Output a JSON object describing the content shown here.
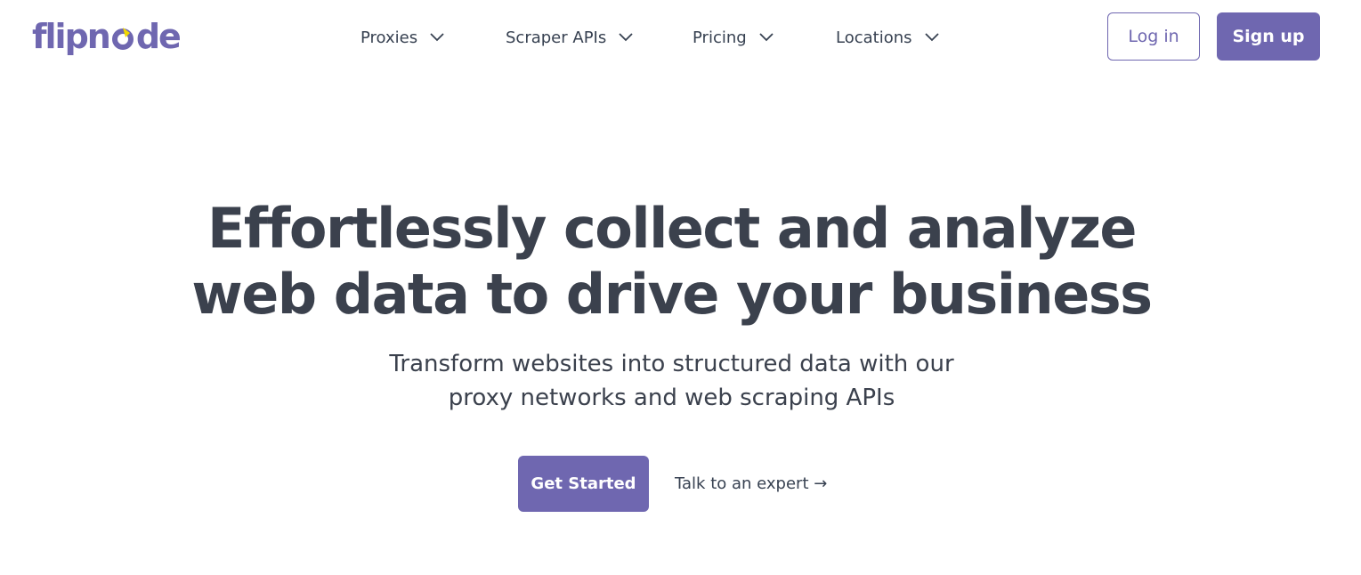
{
  "brand": {
    "logo_prefix": "flipn",
    "logo_suffix": "de",
    "primary_color": "#6f67b0",
    "accent_color": "#f1d800"
  },
  "nav": {
    "items": [
      {
        "label": "Proxies",
        "icon": "chevron-down-icon"
      },
      {
        "label": "Scraper APIs",
        "icon": "chevron-down-icon"
      },
      {
        "label": "Pricing",
        "icon": "chevron-down-icon"
      },
      {
        "label": "Locations",
        "icon": "chevron-down-icon"
      }
    ]
  },
  "auth": {
    "login_label": "Log in",
    "signup_label": "Sign up"
  },
  "hero": {
    "title_line1": "Effortlessly collect and analyze",
    "title_line2": "web data to drive your business",
    "subtitle_line1": "Transform websites into structured data with our",
    "subtitle_line2": "proxy networks and web scraping APIs",
    "primary_cta": "Get Started",
    "secondary_cta": "Talk to an expert →"
  }
}
